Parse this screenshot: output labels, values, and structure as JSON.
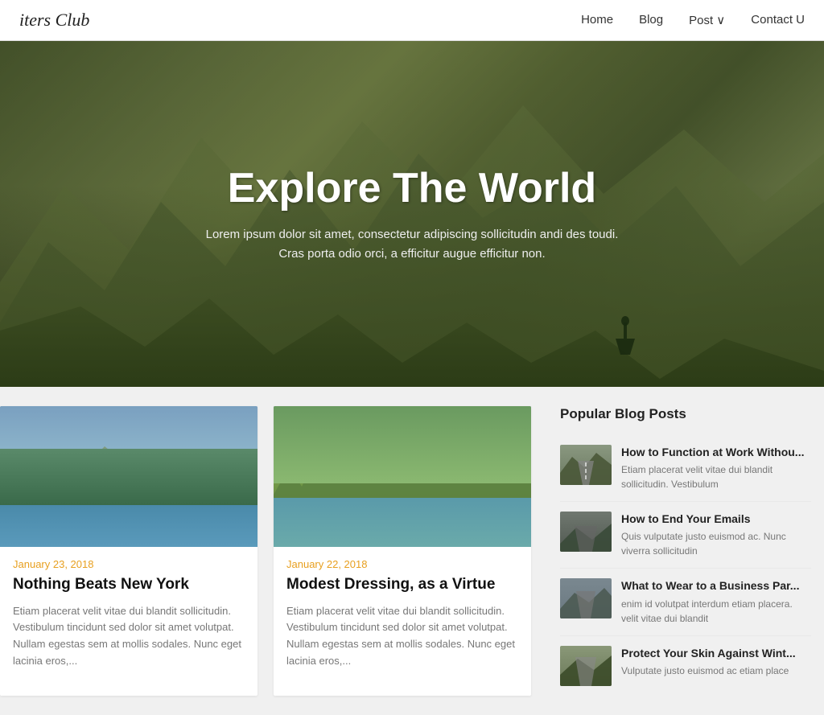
{
  "header": {
    "logo": "iters Club",
    "nav": [
      {
        "label": "Home",
        "href": "#"
      },
      {
        "label": "Blog",
        "href": "#"
      },
      {
        "label": "Post ∨",
        "href": "#"
      },
      {
        "label": "Contact U",
        "href": "#"
      }
    ]
  },
  "hero": {
    "title": "Explore The World",
    "subtitle_line1": "Lorem ipsum dolor sit amet, consectetur adipiscing sollicitudin andi des toudi.",
    "subtitle_line2": "Cras porta odio orci, a efficitur augue efficitur non."
  },
  "posts": [
    {
      "date": "January 23, 2018",
      "title": "Nothing Beats New York",
      "excerpt": "Etiam placerat velit vitae dui blandit sollicitudin. Vestibulum tincidunt sed dolor sit amet volutpat. Nullam egestas sem at mollis sodales. Nunc eget lacinia eros,..."
    },
    {
      "date": "January 22, 2018",
      "title": "Modest Dressing, as a Virtue",
      "excerpt": "Etiam placerat velit vitae dui blandit sollicitudin. Vestibulum tincidunt sed dolor sit amet volutpat. Nullam egestas sem at mollis sodales. Nunc eget lacinia eros,..."
    }
  ],
  "sidebar": {
    "title": "Popular Blog Posts",
    "posts": [
      {
        "title": "How to Function at Work Withou...",
        "excerpt": "Etiam placerat velit vitae dui blandit sollicitudin. Vestibulum"
      },
      {
        "title": "How to End Your Emails",
        "excerpt": "Quis vulputate justo euismod ac. Nunc viverra sollicitudin"
      },
      {
        "title": "What to Wear to a Business Par...",
        "excerpt": "enim id volutpat interdum etiam placera. velit vitae dui blandit"
      },
      {
        "title": "Protect Your Skin Against Wint...",
        "excerpt": "Vulputate justo euismod ac etiam place"
      }
    ]
  }
}
